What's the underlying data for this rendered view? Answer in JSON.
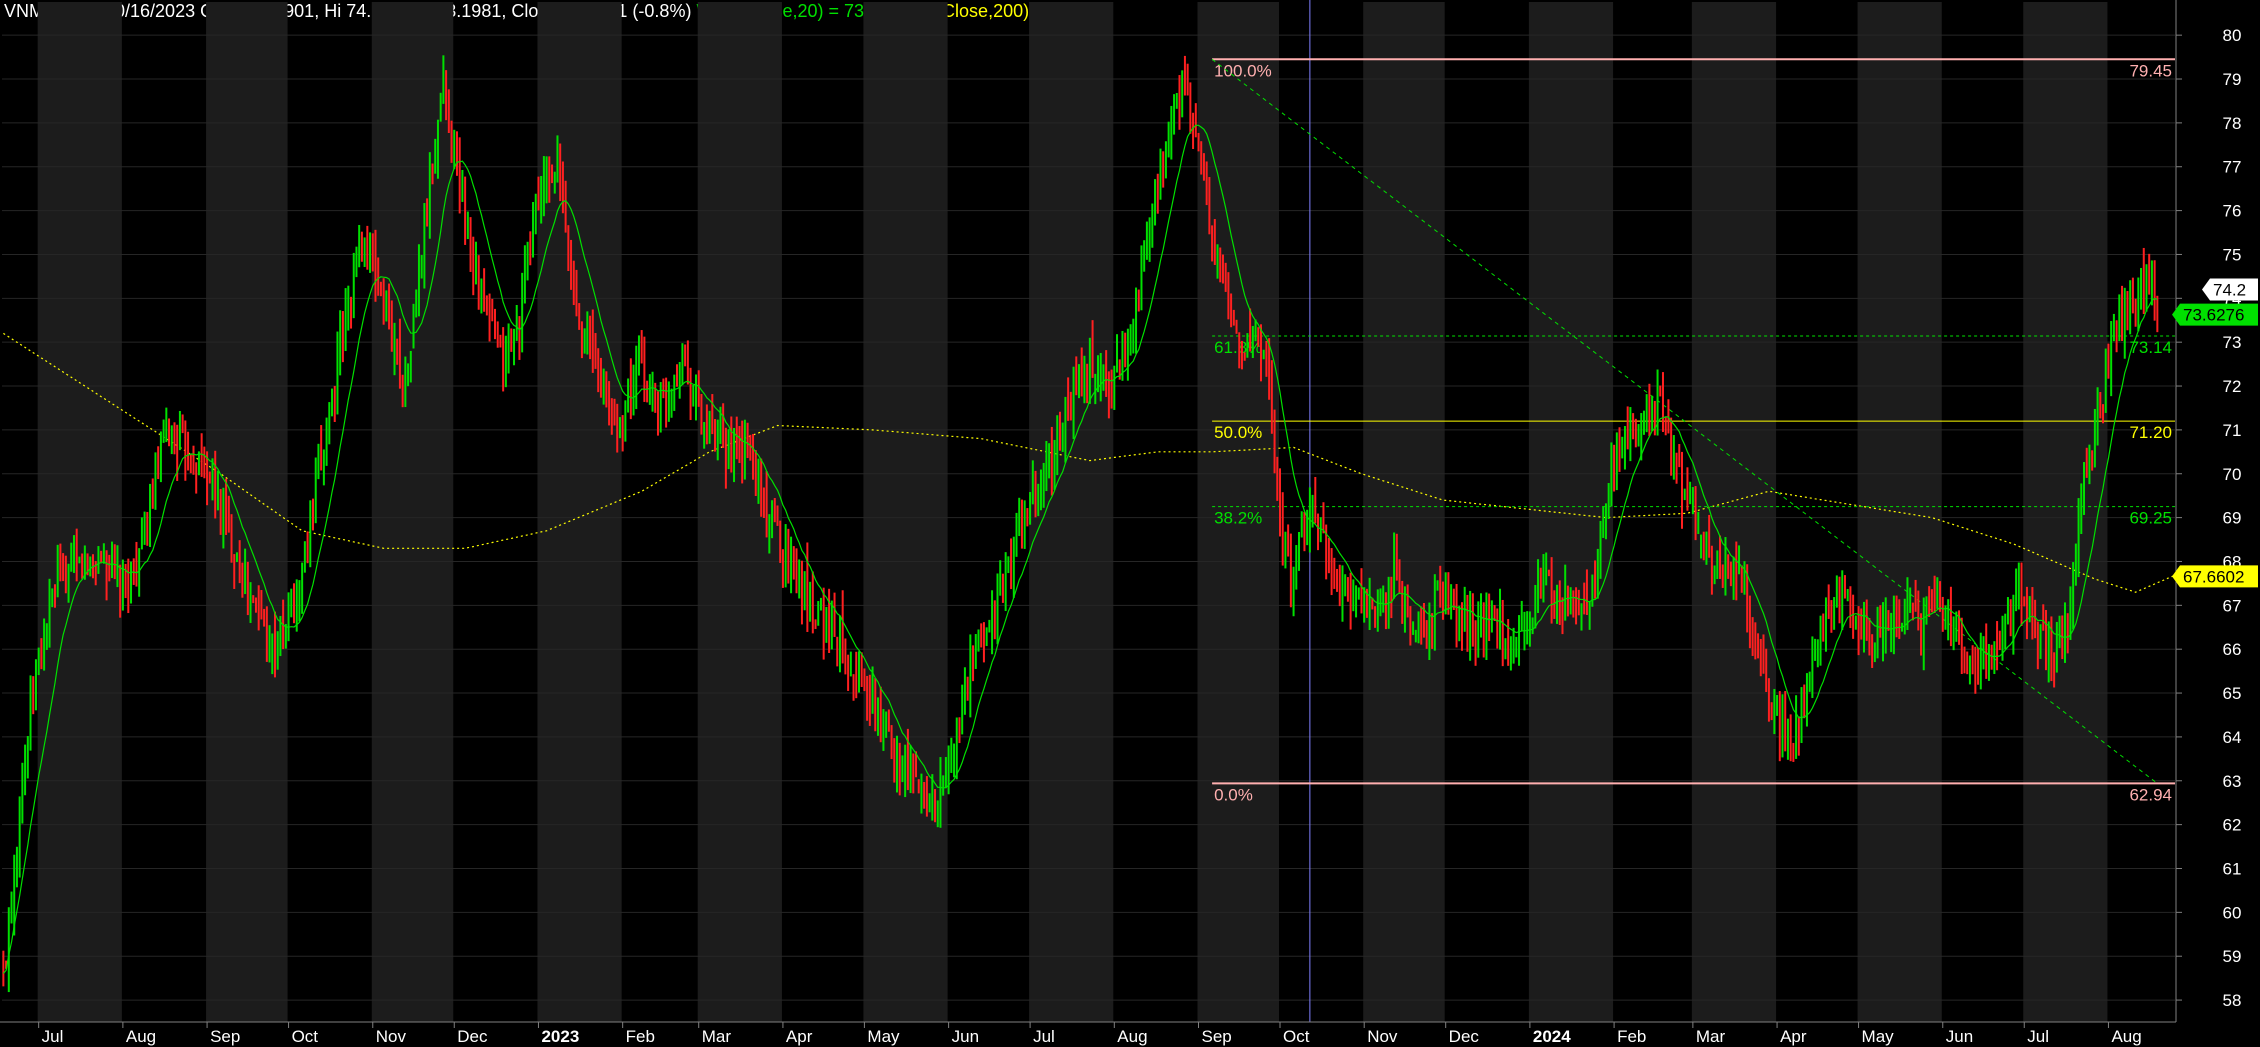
{
  "header": {
    "title": "VNM - Daily 10/16/2023 Open 73.5901, Hi 74.276, Lo 73.1981, Close 73.6881 (-0.8%)",
    "wma": "WMA(Close,20) = 73.43,",
    "ma": "MA1(Close,200) = 70.71"
  },
  "colors": {
    "background": "#000000",
    "band_alt": "#1c1c1c",
    "up_bar": "#00e000",
    "down_bar": "#ff2020",
    "wma_line": "#00e000",
    "ma200_line": "#ffff00",
    "fib_pink": "#ffb0b0",
    "fib_green": "#00e000",
    "fib_yellow": "#ffff00",
    "axis_text": "#ffffff"
  },
  "chart_data": {
    "type": "candlestick",
    "ylim": [
      57.5,
      80.3
    ],
    "yticks": [
      58,
      59,
      60,
      61,
      62,
      63,
      64,
      65,
      66,
      67,
      68,
      69,
      70,
      71,
      72,
      73,
      74,
      75,
      76,
      77,
      78,
      79,
      80
    ],
    "xlabels": [
      {
        "label": "Jul",
        "day": 13
      },
      {
        "label": "Aug",
        "day": 44
      },
      {
        "label": "Sep",
        "day": 75
      },
      {
        "label": "Oct",
        "day": 105
      },
      {
        "label": "Nov",
        "day": 136
      },
      {
        "label": "Dec",
        "day": 166
      },
      {
        "label": "2023",
        "day": 197,
        "bold": true
      },
      {
        "label": "Feb",
        "day": 228
      },
      {
        "label": "Mar",
        "day": 256
      },
      {
        "label": "Apr",
        "day": 287
      },
      {
        "label": "May",
        "day": 317
      },
      {
        "label": "Jun",
        "day": 348
      },
      {
        "label": "Jul",
        "day": 378
      },
      {
        "label": "Aug",
        "day": 409
      },
      {
        "label": "Sep",
        "day": 440
      },
      {
        "label": "Oct",
        "day": 470
      },
      {
        "label": "Nov",
        "day": 501
      },
      {
        "label": "Dec",
        "day": 531
      },
      {
        "label": "2024",
        "day": 562,
        "bold": true
      },
      {
        "label": "Feb",
        "day": 593
      },
      {
        "label": "Mar",
        "day": 622
      },
      {
        "label": "Apr",
        "day": 653
      },
      {
        "label": "May",
        "day": 683
      },
      {
        "label": "Jun",
        "day": 714
      },
      {
        "label": "Jul",
        "day": 744
      },
      {
        "label": "Aug",
        "day": 775
      }
    ],
    "close_anchors": [
      [
        0,
        58.4
      ],
      [
        6,
        62.5
      ],
      [
        12,
        65.5
      ],
      [
        20,
        67.6
      ],
      [
        28,
        67.9
      ],
      [
        36,
        68.1
      ],
      [
        44,
        67.3
      ],
      [
        52,
        68.5
      ],
      [
        60,
        71.0
      ],
      [
        68,
        70.5
      ],
      [
        76,
        70.0
      ],
      [
        84,
        68.5
      ],
      [
        92,
        67.0
      ],
      [
        100,
        66.0
      ],
      [
        108,
        67.0
      ],
      [
        116,
        70.0
      ],
      [
        124,
        72.8
      ],
      [
        132,
        75.5
      ],
      [
        140,
        74.0
      ],
      [
        148,
        72.0
      ],
      [
        156,
        76.0
      ],
      [
        162,
        79.0
      ],
      [
        168,
        76.5
      ],
      [
        176,
        74.0
      ],
      [
        184,
        72.5
      ],
      [
        190,
        73.5
      ],
      [
        196,
        76.2
      ],
      [
        204,
        77.0
      ],
      [
        210,
        74.0
      ],
      [
        218,
        72.5
      ],
      [
        226,
        71.0
      ],
      [
        234,
        72.5
      ],
      [
        242,
        71.5
      ],
      [
        250,
        72.8
      ],
      [
        258,
        71.0
      ],
      [
        266,
        70.5
      ],
      [
        274,
        70.5
      ],
      [
        282,
        69.0
      ],
      [
        290,
        68.0
      ],
      [
        298,
        67.0
      ],
      [
        306,
        66.5
      ],
      [
        314,
        65.5
      ],
      [
        322,
        64.5
      ],
      [
        330,
        63.5
      ],
      [
        338,
        62.8
      ],
      [
        344,
        62.5
      ],
      [
        350,
        63.8
      ],
      [
        356,
        65.5
      ],
      [
        362,
        66.5
      ],
      [
        368,
        67.5
      ],
      [
        376,
        69.0
      ],
      [
        384,
        70.0
      ],
      [
        392,
        71.5
      ],
      [
        400,
        72.5
      ],
      [
        408,
        72.0
      ],
      [
        416,
        73.5
      ],
      [
        424,
        76.0
      ],
      [
        430,
        78.0
      ],
      [
        434,
        78.8
      ],
      [
        440,
        77.5
      ],
      [
        446,
        75.0
      ],
      [
        452,
        73.5
      ],
      [
        458,
        72.8
      ],
      [
        462,
        73.2
      ],
      [
        466,
        72.0
      ],
      [
        470,
        69.0
      ],
      [
        474,
        67.5
      ],
      [
        478,
        68.5
      ],
      [
        482,
        69.3
      ],
      [
        488,
        68.0
      ],
      [
        494,
        67.3
      ],
      [
        500,
        67.0
      ],
      [
        506,
        66.5
      ],
      [
        512,
        67.8
      ],
      [
        518,
        66.5
      ],
      [
        524,
        66.5
      ],
      [
        530,
        67.5
      ],
      [
        536,
        66.8
      ],
      [
        542,
        66.5
      ],
      [
        548,
        66.8
      ],
      [
        554,
        66.3
      ],
      [
        560,
        66.5
      ],
      [
        566,
        67.5
      ],
      [
        572,
        67.3
      ],
      [
        580,
        66.8
      ],
      [
        586,
        67.5
      ],
      [
        592,
        70.0
      ],
      [
        598,
        70.8
      ],
      [
        604,
        71.5
      ],
      [
        610,
        71.5
      ],
      [
        616,
        70.0
      ],
      [
        622,
        69.0
      ],
      [
        628,
        68.0
      ],
      [
        634,
        67.8
      ],
      [
        640,
        67.5
      ],
      [
        646,
        66.0
      ],
      [
        652,
        64.5
      ],
      [
        658,
        63.8
      ],
      [
        664,
        65.0
      ],
      [
        670,
        66.5
      ],
      [
        676,
        67.2
      ],
      [
        682,
        66.5
      ],
      [
        688,
        66.0
      ],
      [
        694,
        66.5
      ],
      [
        700,
        67.0
      ],
      [
        706,
        66.5
      ],
      [
        712,
        67.3
      ],
      [
        718,
        66.3
      ],
      [
        724,
        65.5
      ],
      [
        730,
        65.8
      ],
      [
        736,
        66.5
      ],
      [
        742,
        67.3
      ],
      [
        748,
        66.2
      ],
      [
        754,
        66.0
      ],
      [
        760,
        66.3
      ],
      [
        766,
        70.0
      ],
      [
        772,
        71.5
      ],
      [
        778,
        73.5
      ],
      [
        784,
        74.0
      ],
      [
        790,
        74.5
      ],
      [
        793,
        73.7
      ]
    ],
    "ma200_anchors": [
      [
        0,
        73.2
      ],
      [
        40,
        71.6
      ],
      [
        80,
        70.0
      ],
      [
        110,
        68.7
      ],
      [
        140,
        68.3
      ],
      [
        170,
        68.3
      ],
      [
        200,
        68.7
      ],
      [
        235,
        69.6
      ],
      [
        260,
        70.5
      ],
      [
        285,
        71.1
      ],
      [
        320,
        71.0
      ],
      [
        360,
        70.8
      ],
      [
        400,
        70.3
      ],
      [
        425,
        70.5
      ],
      [
        445,
        70.5
      ],
      [
        475,
        70.6
      ],
      [
        500,
        70.0
      ],
      [
        530,
        69.4
      ],
      [
        560,
        69.2
      ],
      [
        590,
        69.0
      ],
      [
        620,
        69.1
      ],
      [
        650,
        69.6
      ],
      [
        680,
        69.3
      ],
      [
        710,
        69.0
      ],
      [
        740,
        68.4
      ],
      [
        770,
        67.6
      ],
      [
        785,
        67.3
      ],
      [
        800,
        67.7
      ]
    ],
    "fib_levels": [
      {
        "pct": "100.0%",
        "value_label": "79.45",
        "price": 79.45,
        "style": "pink"
      },
      {
        "pct": "61.8%",
        "value_label": "73.14",
        "price": 73.14,
        "style": "green"
      },
      {
        "pct": "50.0%",
        "value_label": "71.20",
        "price": 71.2,
        "style": "yellow"
      },
      {
        "pct": "38.2%",
        "value_label": "69.25",
        "price": 69.25,
        "style": "green"
      },
      {
        "pct": "0.0%",
        "value_label": "62.94",
        "price": 62.94,
        "style": "pink"
      }
    ],
    "fib_start_day": 445,
    "diag_line": {
      "from": [
        445,
        79.45
      ],
      "to": [
        793,
        62.94
      ]
    },
    "cursor_day": 481,
    "last_day": 800,
    "price_tags": [
      {
        "label": "74.2",
        "price": 74.2,
        "bg": "#ffffff",
        "fg": "#000000"
      },
      {
        "label": "73.6276",
        "price": 73.6276,
        "bg": "#00e000",
        "fg": "#000000"
      },
      {
        "label": "67.6602",
        "price": 67.6602,
        "bg": "#ffff00",
        "fg": "#000000"
      }
    ]
  }
}
